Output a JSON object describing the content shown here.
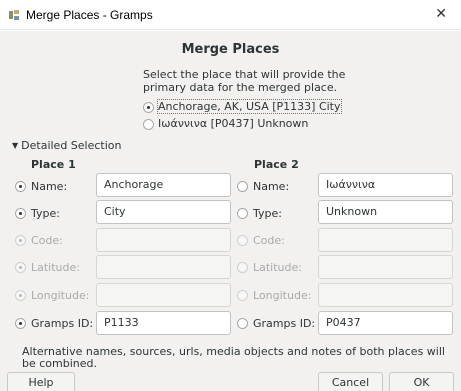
{
  "window": {
    "title": "Merge Places - Gramps",
    "close_glyph": "✕"
  },
  "dialog": {
    "heading": "Merge Places",
    "instructions": "Select the place that will provide the primary data for the merged place.",
    "options": [
      {
        "label": "Anchorage, AK, USA [P1133] City",
        "checked": true
      },
      {
        "label": "Ιωάννινα [P0437] Unknown",
        "checked": false
      }
    ],
    "expander_label": "Detailed Selection",
    "place1": {
      "header": "Place 1",
      "rows": [
        {
          "label": "Name:",
          "value": "Anchorage",
          "checked": true,
          "enabled": true
        },
        {
          "label": "Type:",
          "value": "City",
          "checked": true,
          "enabled": true
        },
        {
          "label": "Code:",
          "value": "",
          "checked": true,
          "enabled": false
        },
        {
          "label": "Latitude:",
          "value": "",
          "checked": true,
          "enabled": false
        },
        {
          "label": "Longitude:",
          "value": "",
          "checked": true,
          "enabled": false
        },
        {
          "label": "Gramps ID:",
          "value": "P1133",
          "checked": true,
          "enabled": true
        }
      ]
    },
    "place2": {
      "header": "Place 2",
      "rows": [
        {
          "label": "Name:",
          "value": "Ιωάννινα",
          "checked": false,
          "enabled": true
        },
        {
          "label": "Type:",
          "value": "Unknown",
          "checked": false,
          "enabled": true
        },
        {
          "label": "Code:",
          "value": "",
          "checked": false,
          "enabled": false
        },
        {
          "label": "Latitude:",
          "value": "",
          "checked": false,
          "enabled": false
        },
        {
          "label": "Longitude:",
          "value": "",
          "checked": false,
          "enabled": false
        },
        {
          "label": "Gramps ID:",
          "value": "P0437",
          "checked": false,
          "enabled": true
        }
      ]
    },
    "note": "Alternative names, sources, urls, media objects and notes of both places will be combined."
  },
  "buttons": {
    "help": "Help",
    "cancel": "Cancel",
    "ok": "OK"
  },
  "icons": {
    "app": "gramps-merge-icon",
    "close": "close-icon",
    "expander": "triangle-down-icon"
  }
}
